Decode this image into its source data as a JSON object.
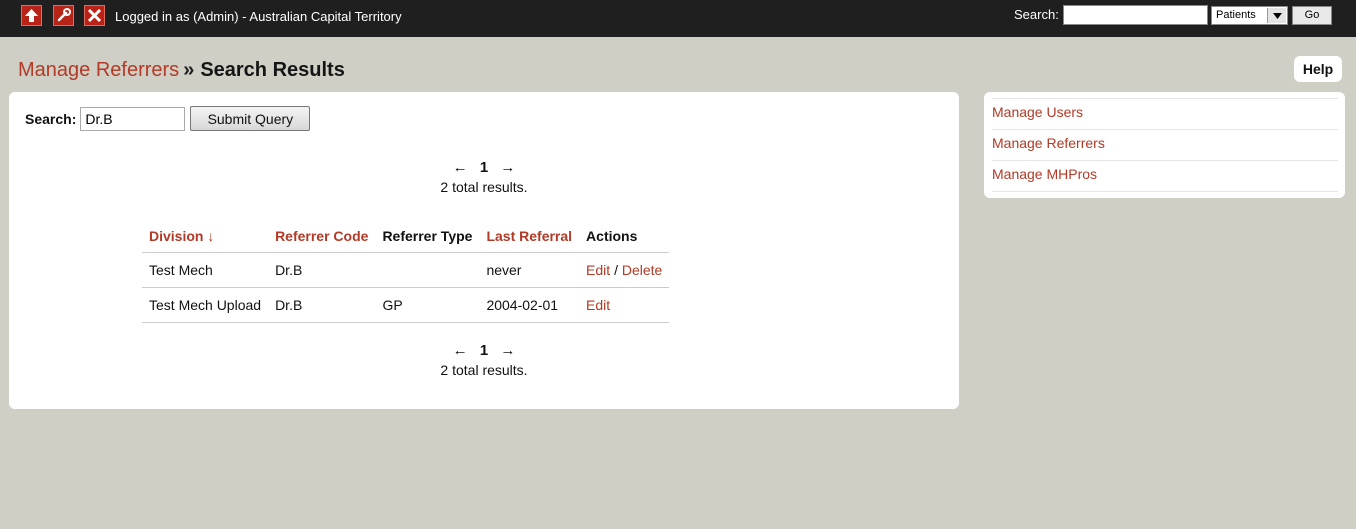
{
  "topbar": {
    "status_text": "Logged in as (Admin) - Australian Capital Territory",
    "search_label": "Search:",
    "search_value": "",
    "select_value": "Patients",
    "go_label": "Go",
    "icons": [
      "home-up-icon",
      "wrench-icon",
      "close-icon"
    ],
    "icon_color": "#b82317"
  },
  "breadcrumb": {
    "parent": "Manage Referrers",
    "separator": "»",
    "current": "Search Results"
  },
  "help_label": "Help",
  "search": {
    "label": "Search:",
    "value": "Dr.B",
    "submit_label": "Submit Query"
  },
  "pagination": {
    "prev": "←",
    "page": "1",
    "next": "→",
    "total_text": "2 total results."
  },
  "table": {
    "headers": {
      "division": "Division ↓",
      "referrer_code": "Referrer Code",
      "referrer_type": "Referrer Type",
      "last_referral": "Last Referral",
      "actions": "Actions"
    },
    "rows": [
      {
        "division": "Test Mech",
        "referrer_code": "Dr.B",
        "referrer_type": "",
        "last_referral": "never",
        "edit": "Edit",
        "action_sep": "/",
        "delete": "Delete"
      },
      {
        "division": "Test Mech Upload",
        "referrer_code": "Dr.B",
        "referrer_type": "GP",
        "last_referral": "2004-02-01",
        "edit": "Edit"
      }
    ]
  },
  "sidebar": {
    "items": [
      {
        "label": "Manage Users"
      },
      {
        "label": "Manage Referrers"
      },
      {
        "label": "Manage MHPros"
      }
    ]
  },
  "colors": {
    "link": "#b23a26",
    "background": "#cfcfc6",
    "topbar": "#1f1f1f"
  }
}
